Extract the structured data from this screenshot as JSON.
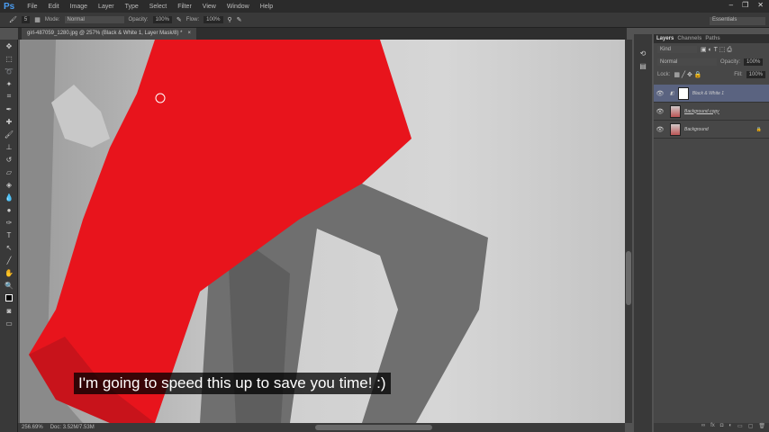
{
  "app": {
    "logo": "Ps"
  },
  "menu": [
    "File",
    "Edit",
    "Image",
    "Layer",
    "Type",
    "Select",
    "Filter",
    "View",
    "Window",
    "Help"
  ],
  "options": {
    "brush_size": "5",
    "mode_label": "Mode:",
    "mode": "Normal",
    "opacity_label": "Opacity:",
    "opacity": "100%",
    "flow_label": "Flow:",
    "flow": "100%",
    "workspace": "Essentials"
  },
  "document": {
    "tab_title": "girl-487059_1280.jpg @ 257% (Black & White 1, Layer Mask/8) *",
    "close": "×"
  },
  "status": {
    "zoom": "256.69%",
    "doc": "Doc: 3.52M/7.53M"
  },
  "caption": "I'm going to speed this up to save you time! :)",
  "layers_panel": {
    "tabs": [
      "Layers",
      "Channels",
      "Paths"
    ],
    "filter": "Kind",
    "blend_mode": "Normal",
    "opacity_label": "Opacity:",
    "opacity": "100%",
    "lock_label": "Lock:",
    "fill_label": "Fill:",
    "fill": "100%",
    "layers": [
      {
        "name": "Black & White 1",
        "selected": true
      },
      {
        "name": "Background copy"
      },
      {
        "name": "Background",
        "locked": true
      }
    ]
  },
  "colors": {
    "dress": "#e8141c",
    "accent": "#4a9cf0"
  }
}
